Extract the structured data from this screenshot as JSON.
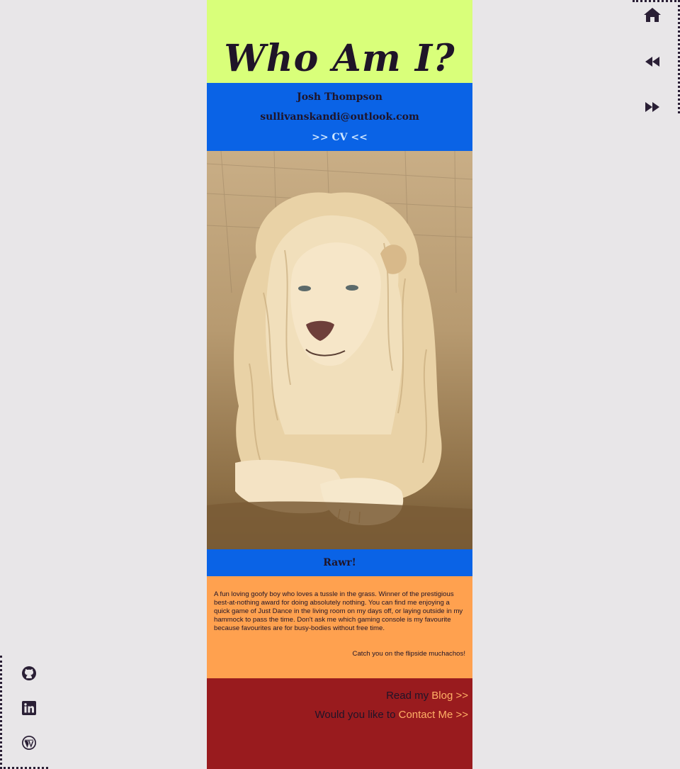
{
  "header": {
    "title": "Who Am I?"
  },
  "contact": {
    "name": "Josh Thompson",
    "email": "sullivanskandi@outlook.com",
    "cv_link": ">> CV <<"
  },
  "photo": {
    "subject": "white lion lying on grass"
  },
  "caption": "Rawr!",
  "bio": {
    "about": "A fun loving goofy boy who loves a tussle in the grass. Winner of the prestigious best-at-nothing award for doing absolutely nothing. You can find me enjoying a quick game of Just Dance in the living room on my days off, or laying outside in my hammock to pass the time. Don't ask me which gaming console is my favourite because favourites are for busy-bodies without free time.",
    "signoff": "Catch you on the flipside muchachos!"
  },
  "footer": {
    "blog_prefix": "Read my ",
    "blog_link": "Blog >>",
    "contact_prefix": "Would you like to ",
    "contact_link": "Contact Me >>"
  },
  "nav": {
    "icons": [
      "home-icon",
      "rewind-icon",
      "fast-forward-icon"
    ]
  },
  "social": {
    "icons": [
      "github-icon",
      "linkedin-icon",
      "wordpress-icon"
    ]
  },
  "colors": {
    "background": "#e8e6e8",
    "header": "#d9ff7a",
    "blue_band": "#0a63e6",
    "bio": "#ffa14f",
    "footer": "#991b1e",
    "link": "#ffb066",
    "ink": "#1f1428"
  }
}
